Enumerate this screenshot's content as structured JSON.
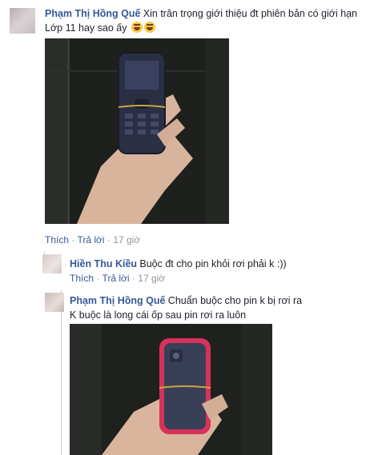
{
  "comment1": {
    "author": "Phạm Thị Hồng Quế",
    "text_line1": "Xin trân trọng giới thiệu đt phiên bản có giới hạn",
    "text_line2": "Lớp 11 hay sao ấy",
    "photo": "photo of a hand holding a dark blue feature phone with a rubber band around it",
    "like": "Thích",
    "reply": "Trả lời",
    "sep": "·",
    "time": "17 giờ"
  },
  "reply1": {
    "author": "Hiền Thu Kiều",
    "text": "Buộc đt cho pin khỏi rơi phải k :))",
    "like": "Thích",
    "reply": "Trả lời",
    "sep": "·",
    "time": "17 giờ"
  },
  "reply2": {
    "author": "Phạm Thị Hồng Quế",
    "text_line1": "Chuẩn buộc cho pin k bị rơi ra",
    "text_line2": "K buộc là long cái ốp sau pin rơi ra luôn",
    "photo": "photo of a hand holding the back of a phone with a pink frame and a rubber band"
  },
  "colors": {
    "name": "#365899",
    "text": "#1d2129",
    "meta": "#90949c",
    "line": "#ced0d4"
  },
  "icons": [
    "laughing-emoji",
    "laughing-emoji"
  ]
}
